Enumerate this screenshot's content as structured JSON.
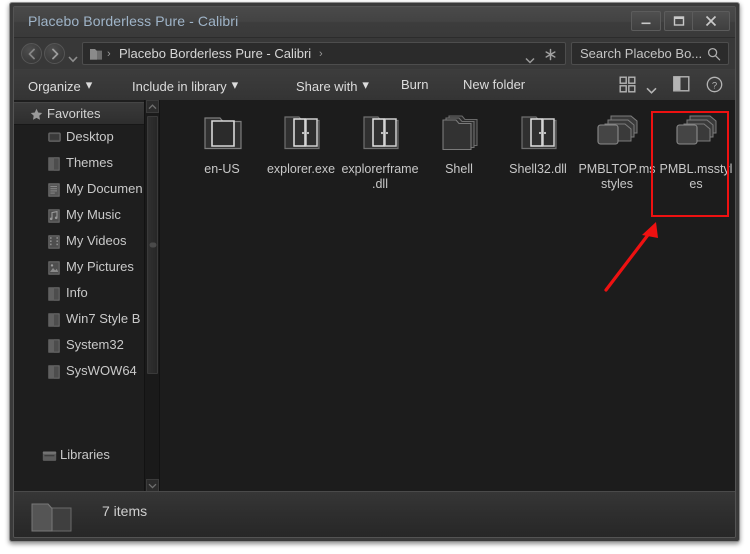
{
  "window": {
    "title": "Placebo Borderless Pure - Calibri",
    "controls": {
      "minimize": "Minimize",
      "maximize": "Maximize",
      "close": "Close"
    }
  },
  "navbar": {
    "back": "Back",
    "forward": "Forward",
    "recent_pages": "Recent pages",
    "breadcrumb": "Placebo Borderless Pure - Calibri",
    "separator": "›",
    "address_dropdown": "Previous locations",
    "refresh": "Refresh",
    "folder_icon": "folder-icon"
  },
  "search": {
    "placeholder": "Search Placebo Bo...",
    "icon": "search-icon"
  },
  "toolbar": {
    "organize": "Organize",
    "include_in_library": "Include in library",
    "share_with": "Share with",
    "burn": "Burn",
    "new_folder": "New folder",
    "caret": "▾",
    "view_icon": "view-layout-icon",
    "view_caret": "chevron-down-icon",
    "preview_pane": "preview-pane-icon",
    "help": "?"
  },
  "sidebar": {
    "header": "Favorites",
    "header_icon": "star-icon",
    "items": [
      {
        "label": "Desktop",
        "icon": "desktop-icon"
      },
      {
        "label": "Themes",
        "icon": "folder-icon"
      },
      {
        "label": "My Documen",
        "icon": "documents-icon"
      },
      {
        "label": "My Music",
        "icon": "music-icon"
      },
      {
        "label": "My Videos",
        "icon": "videos-icon"
      },
      {
        "label": "My Pictures",
        "icon": "pictures-icon"
      },
      {
        "label": "Info",
        "icon": "folder-icon"
      },
      {
        "label": "Win7 Style B",
        "icon": "folder-icon"
      },
      {
        "label": "System32",
        "icon": "folder-icon"
      },
      {
        "label": "SysWOW64",
        "icon": "folder-icon"
      }
    ],
    "libraries": {
      "label": "Libraries",
      "icon": "libraries-icon"
    }
  },
  "files": [
    {
      "name": "en-US",
      "icon": "open-folder-icon"
    },
    {
      "name": "explorer.exe",
      "icon": "door-folder-icon"
    },
    {
      "name": "explorerframe.dll",
      "icon": "door-folder-icon"
    },
    {
      "name": "Shell",
      "icon": "folder-stack-icon"
    },
    {
      "name": "Shell32.dll",
      "icon": "door-folder-icon"
    },
    {
      "name": "PMBLTOP.msstyles",
      "icon": "msstyles-stack-icon"
    },
    {
      "name": "PMBL.msstyles",
      "icon": "msstyles-stack-icon"
    }
  ],
  "statusbar": {
    "item_count": "7 items",
    "icon": "folder-icon"
  },
  "annotation": {
    "highlight_target": "PMBL.msstyles",
    "box_color": "#ee1111",
    "arrow_color": "#ee1111"
  }
}
